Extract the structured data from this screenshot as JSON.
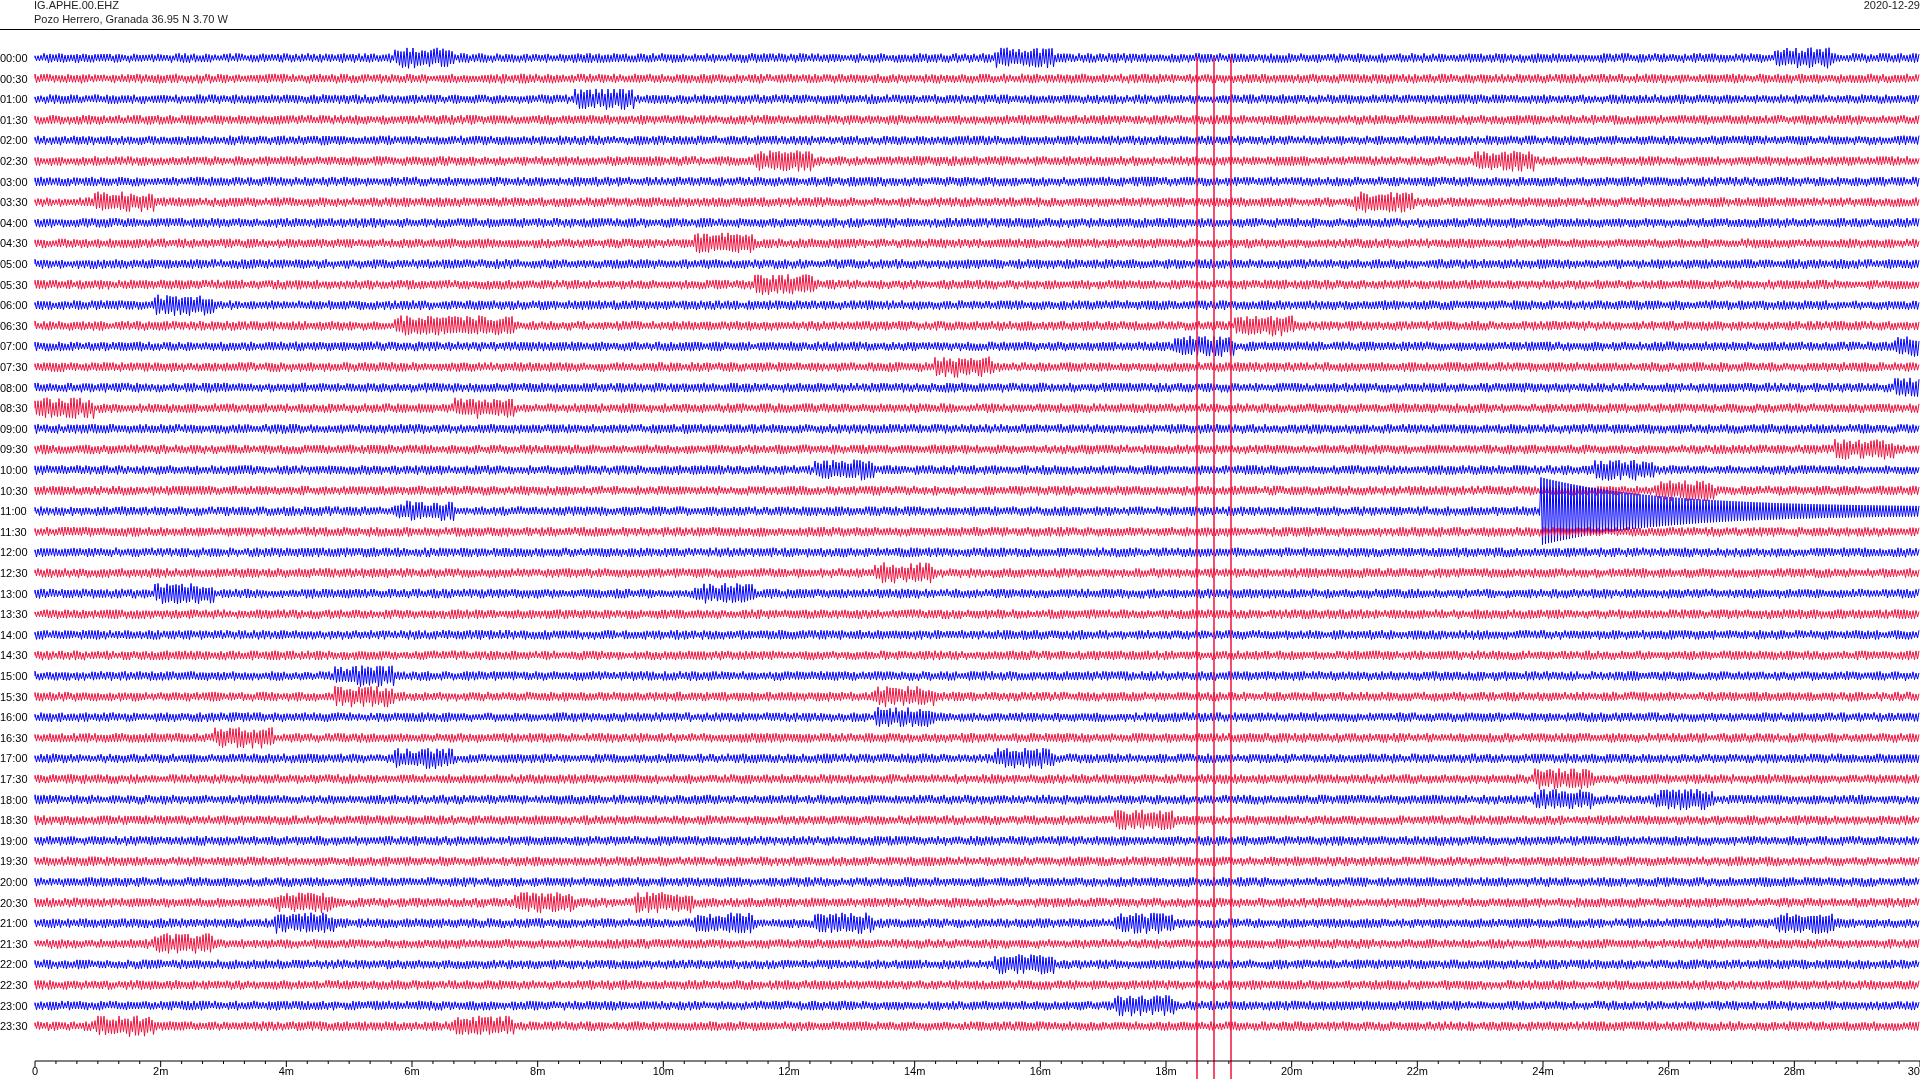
{
  "header": {
    "station": "IG.APHE.00.EHZ",
    "location": "Pozo Herrero, Granada  36.95 N 3.70 W",
    "date": "2020-12-29"
  },
  "rows": [
    {
      "label": "00:00",
      "color": "#0000ff"
    },
    {
      "label": "00:30",
      "color": "#f0103c"
    },
    {
      "label": "01:00",
      "color": "#0000ff"
    },
    {
      "label": "01:30",
      "color": "#f0103c"
    },
    {
      "label": "02:00",
      "color": "#0000ff"
    },
    {
      "label": "02:30",
      "color": "#f0103c"
    },
    {
      "label": "03:00",
      "color": "#0000ff"
    },
    {
      "label": "03:30",
      "color": "#f0103c"
    },
    {
      "label": "04:00",
      "color": "#0000ff"
    },
    {
      "label": "04:30",
      "color": "#f0103c"
    },
    {
      "label": "05:00",
      "color": "#0000ff"
    },
    {
      "label": "05:30",
      "color": "#f0103c"
    },
    {
      "label": "06:00",
      "color": "#0000ff"
    },
    {
      "label": "06:30",
      "color": "#f0103c"
    },
    {
      "label": "07:00",
      "color": "#0000ff"
    },
    {
      "label": "07:30",
      "color": "#f0103c"
    },
    {
      "label": "08:00",
      "color": "#0000ff"
    },
    {
      "label": "08:30",
      "color": "#f0103c"
    },
    {
      "label": "09:00",
      "color": "#0000ff"
    },
    {
      "label": "09:30",
      "color": "#f0103c"
    },
    {
      "label": "10:00",
      "color": "#0000ff"
    },
    {
      "label": "10:30",
      "color": "#f0103c"
    },
    {
      "label": "11:00",
      "color": "#0000ff"
    },
    {
      "label": "11:30",
      "color": "#f0103c"
    },
    {
      "label": "12:00",
      "color": "#0000ff"
    },
    {
      "label": "12:30",
      "color": "#f0103c"
    },
    {
      "label": "13:00",
      "color": "#0000ff"
    },
    {
      "label": "13:30",
      "color": "#f0103c"
    },
    {
      "label": "14:00",
      "color": "#0000ff"
    },
    {
      "label": "14:30",
      "color": "#f0103c"
    },
    {
      "label": "15:00",
      "color": "#0000ff"
    },
    {
      "label": "15:30",
      "color": "#f0103c"
    },
    {
      "label": "16:00",
      "color": "#0000ff"
    },
    {
      "label": "16:30",
      "color": "#f0103c"
    },
    {
      "label": "17:00",
      "color": "#0000ff"
    },
    {
      "label": "17:30",
      "color": "#f0103c"
    },
    {
      "label": "18:00",
      "color": "#0000ff"
    },
    {
      "label": "18:30",
      "color": "#f0103c"
    },
    {
      "label": "19:00",
      "color": "#0000ff"
    },
    {
      "label": "19:30",
      "color": "#f0103c"
    },
    {
      "label": "20:00",
      "color": "#0000ff"
    },
    {
      "label": "20:30",
      "color": "#f0103c"
    },
    {
      "label": "21:00",
      "color": "#0000ff"
    },
    {
      "label": "21:30",
      "color": "#f0103c"
    },
    {
      "label": "22:00",
      "color": "#0000ff"
    },
    {
      "label": "22:30",
      "color": "#f0103c"
    },
    {
      "label": "23:00",
      "color": "#0000ff"
    },
    {
      "label": "23:30",
      "color": "#f0103c"
    }
  ],
  "axis_labels": [
    "0",
    "2m",
    "4m",
    "6m",
    "8m",
    "10m",
    "12m",
    "14m",
    "16m",
    "18m",
    "20m",
    "22m",
    "24m",
    "26m",
    "28m",
    "30"
  ]
}
